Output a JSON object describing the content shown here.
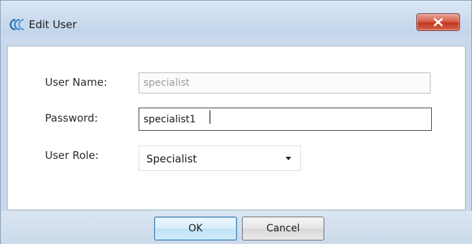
{
  "window": {
    "title": "Edit User",
    "close_icon": "close-icon",
    "app_icon": "app-logo-icon"
  },
  "form": {
    "username_label": "User Name:",
    "username_value": "specialist",
    "password_label": "Password:",
    "password_value": "specialist1",
    "role_label": "User Role:",
    "role_value": "Specialist"
  },
  "buttons": {
    "ok_label": "OK",
    "cancel_label": "Cancel"
  },
  "colors": {
    "close_button": "#c0391f",
    "chrome": "#c9d8ea",
    "default_button_border": "#3d7bad"
  }
}
